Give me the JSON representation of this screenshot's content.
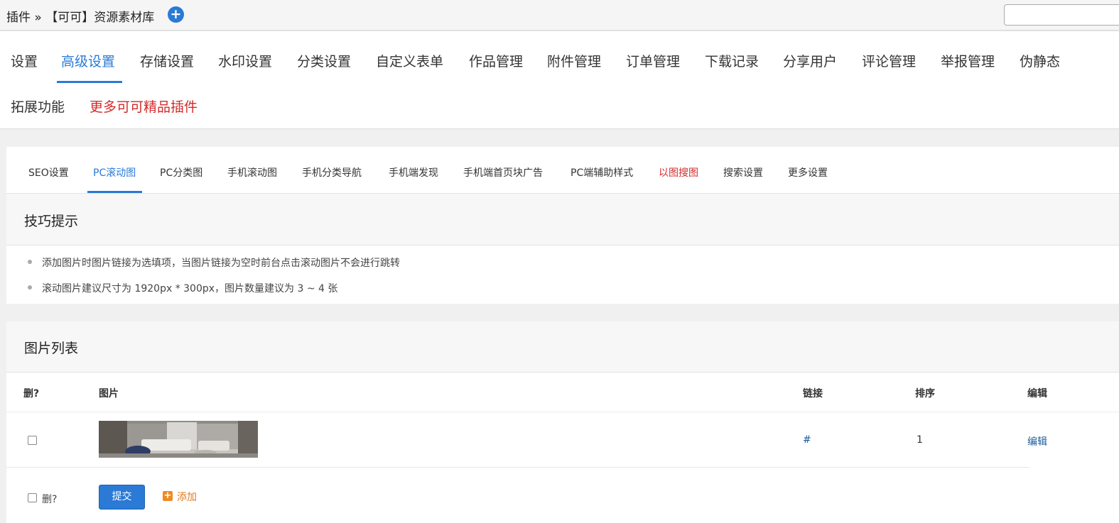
{
  "header": {
    "breadcrumb": "插件 » 【可可】资源素材库",
    "add_icon": "plus-circle-icon",
    "search_value": ""
  },
  "main_nav": {
    "items": [
      "设置",
      "高级设置",
      "存储设置",
      "水印设置",
      "分类设置",
      "自定义表单",
      "作品管理",
      "附件管理",
      "订单管理",
      "下载记录",
      "分享用户",
      "评论管理",
      "举报管理",
      "伪静态",
      "拓展功能",
      "更多可可精品插件"
    ],
    "active_index": 1,
    "highlight_index": 15
  },
  "sub_tabs": {
    "items": [
      "SEO设置",
      "PC滚动图",
      "PC分类图",
      "手机滚动图",
      "手机分类导航",
      "手机端发现",
      "手机端首页块广告",
      "PC端辅助样式",
      "以图搜图",
      "搜索设置",
      "更多设置"
    ],
    "active_index": 1,
    "highlight_index": 8
  },
  "tips": {
    "title": "技巧提示",
    "items": [
      "添加图片时图片链接为选填项，当图片链接为空时前台点击滚动图片不会进行跳转",
      "滚动图片建议尺寸为 1920px * 300px，图片数量建议为 3 ~ 4 张"
    ]
  },
  "image_list": {
    "title": "图片列表",
    "columns": [
      "删?",
      "图片",
      "链接",
      "排序",
      "编辑"
    ],
    "rows": [
      {
        "checked": false,
        "image": "living-room-thumbnail",
        "link": "#",
        "order": "1",
        "edit": "编辑"
      }
    ],
    "footer": {
      "delete_label": "删?",
      "submit_label": "提交",
      "add_label": "添加"
    }
  },
  "colors": {
    "accent": "#2a7ad6",
    "highlight_red": "#d42a2a",
    "add_orange": "#e07b22",
    "link": "#1c5a9c"
  }
}
